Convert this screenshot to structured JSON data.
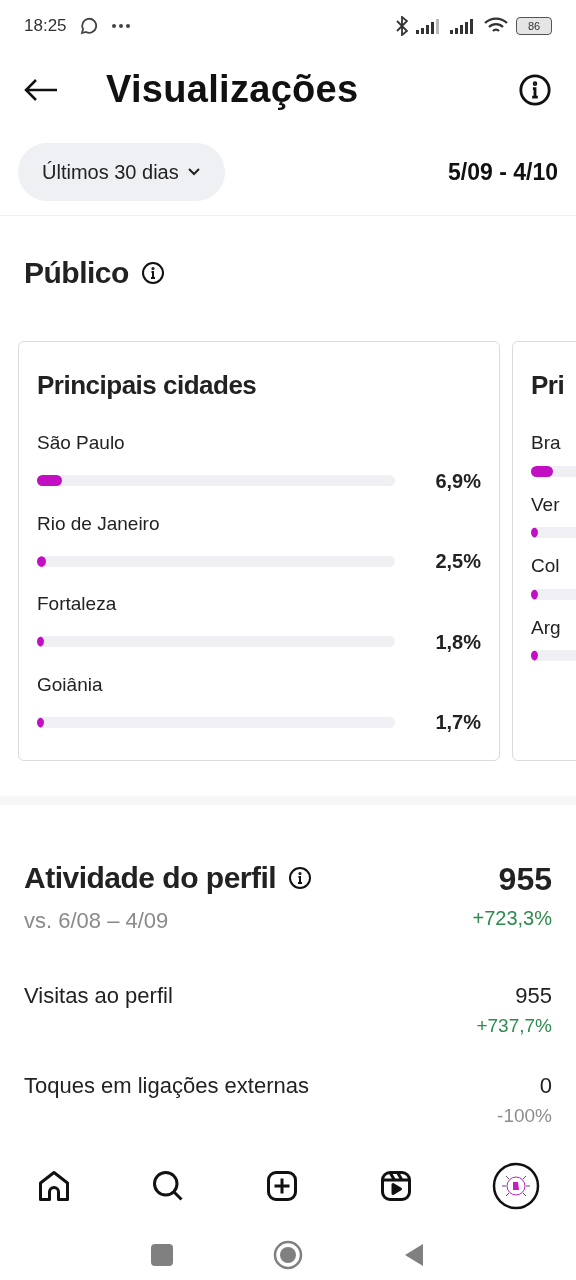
{
  "status_bar": {
    "time": "18:25",
    "battery": "86"
  },
  "header": {
    "title": "Visualizações"
  },
  "filter": {
    "label": "Últimos 30 dias",
    "range": "5/09 - 4/10"
  },
  "audience": {
    "title": "Público",
    "cards": [
      {
        "title": "Principais cidades",
        "rows": [
          {
            "name": "São Paulo",
            "level": 0.069,
            "value": "6,9%"
          },
          {
            "name": "Rio de Janeiro",
            "level": 0.025,
            "value": "2,5%"
          },
          {
            "name": "Fortaleza",
            "level": 0.018,
            "value": "1,8%"
          },
          {
            "name": "Goiânia",
            "level": 0.017,
            "value": "1,7%"
          }
        ]
      },
      {
        "title": "Pri",
        "rows": [
          {
            "name": "Bra",
            "level": 0.06
          },
          {
            "name": "Ver",
            "level": 0.02
          },
          {
            "name": "Col",
            "level": 0.018
          },
          {
            "name": "Arg",
            "level": 0.015
          }
        ]
      }
    ]
  },
  "activity": {
    "title": "Atividade do perfil",
    "compare": "vs. 6/08 – 4/09",
    "total": "955",
    "change": "+723,3%",
    "positive": true,
    "rows": [
      {
        "label": "Visitas ao perfil",
        "value": "955",
        "change": "+737,7%",
        "positive": true
      },
      {
        "label": "Toques em ligações externas",
        "value": "0",
        "change": "-100%",
        "positive": false
      }
    ]
  },
  "nav": {
    "items": [
      {
        "kind": "home"
      },
      {
        "kind": "search"
      },
      {
        "kind": "create"
      },
      {
        "kind": "reels"
      },
      {
        "kind": "profile"
      }
    ]
  }
}
